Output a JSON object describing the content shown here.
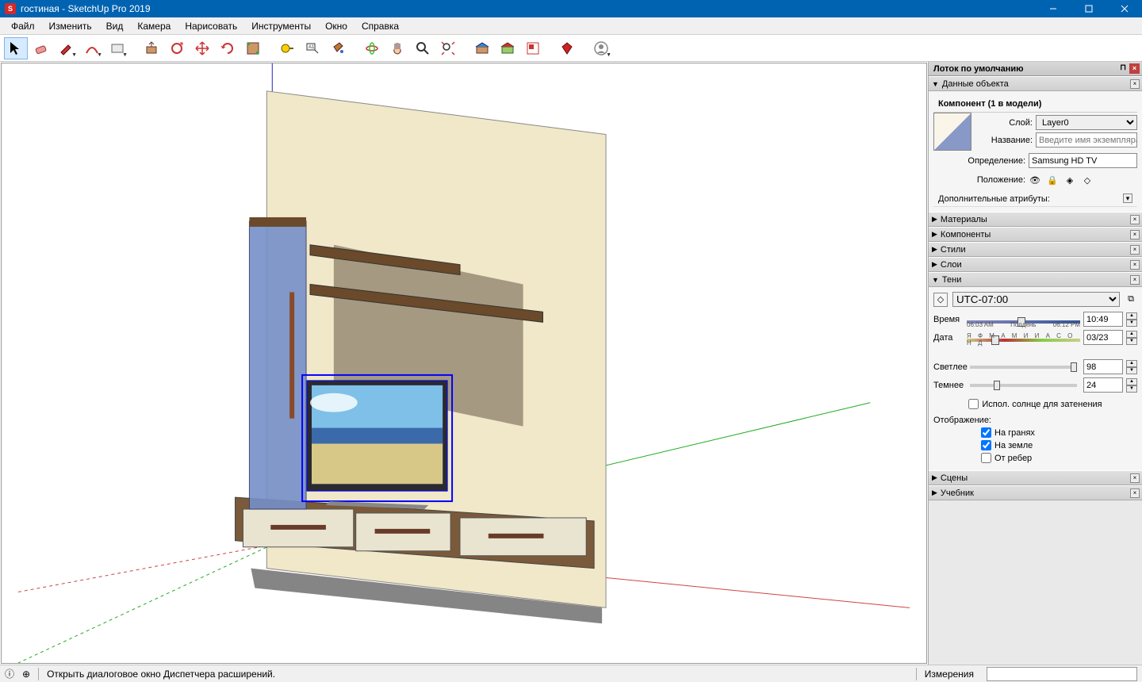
{
  "title": "гостиная - SketchUp Pro 2019",
  "menu": [
    "Файл",
    "Изменить",
    "Вид",
    "Камера",
    "Нарисовать",
    "Инструменты",
    "Окно",
    "Справка"
  ],
  "toolbar": [
    {
      "n": "select",
      "icon": "cursor",
      "dd": false,
      "active": true
    },
    {
      "n": "eraser",
      "icon": "eraser",
      "dd": false
    },
    {
      "n": "line",
      "icon": "pencil",
      "dd": true
    },
    {
      "n": "arc",
      "icon": "arc",
      "dd": true
    },
    {
      "n": "rect",
      "icon": "rect",
      "dd": true
    },
    {
      "n": "sep"
    },
    {
      "n": "pushpull",
      "icon": "pushpull"
    },
    {
      "n": "offset",
      "icon": "offset"
    },
    {
      "n": "move",
      "icon": "move"
    },
    {
      "n": "rotate",
      "icon": "rotate"
    },
    {
      "n": "scale",
      "icon": "scale"
    },
    {
      "n": "sep"
    },
    {
      "n": "tape",
      "icon": "tape"
    },
    {
      "n": "text",
      "icon": "text"
    },
    {
      "n": "paint",
      "icon": "bucket"
    },
    {
      "n": "sep"
    },
    {
      "n": "orbit",
      "icon": "orbit"
    },
    {
      "n": "pan",
      "icon": "pan"
    },
    {
      "n": "zoom",
      "icon": "zoom"
    },
    {
      "n": "zoomext",
      "icon": "zoomext"
    },
    {
      "n": "sep"
    },
    {
      "n": "warehouse",
      "icon": "warehouse"
    },
    {
      "n": "extwarehouse",
      "icon": "extwarehouse"
    },
    {
      "n": "layout",
      "icon": "layout"
    },
    {
      "n": "sep"
    },
    {
      "n": "extension",
      "icon": "gem"
    },
    {
      "n": "sep"
    },
    {
      "n": "user",
      "icon": "user",
      "dd": true
    }
  ],
  "tray": {
    "title": "Лоток по умолчанию",
    "sections": {
      "entity": {
        "title": "Данные объекта",
        "component_label": "Компонент (1 в модели)",
        "layer_label": "Слой:",
        "layer_value": "Layer0",
        "name_label": "Название:",
        "name_placeholder": "Введите имя экземпляра",
        "def_label": "Определение:",
        "def_value": "Samsung HD TV",
        "pos_label": "Положение:",
        "attrs_label": "Дополнительные атрибуты:"
      },
      "materials": "Материалы",
      "components": "Компоненты",
      "styles": "Стили",
      "layers": "Слои",
      "shadows": {
        "title": "Тени",
        "tz": "UTC-07:00",
        "time_label": "Время",
        "time_start": "06:03 AM",
        "time_mid": "Полдень",
        "time_end": "06:12 PM",
        "time_value": "10:49",
        "date_label": "Дата",
        "months": "Я Ф М А М И И А С О Н Д",
        "date_value": "03/23",
        "light_label": "Светлее",
        "light_value": "98",
        "dark_label": "Темнее",
        "dark_value": "24",
        "sun_check": "Испол. солнце для затенения",
        "display_label": "Отображение:",
        "on_faces": "На гранях",
        "on_ground": "На земле",
        "from_edges": "От ребер"
      },
      "scenes": "Сцены",
      "instructor": "Учебник"
    }
  },
  "status": {
    "hint": "Открыть диалоговое окно Диспетчера расширений.",
    "measure": "Измерения"
  }
}
